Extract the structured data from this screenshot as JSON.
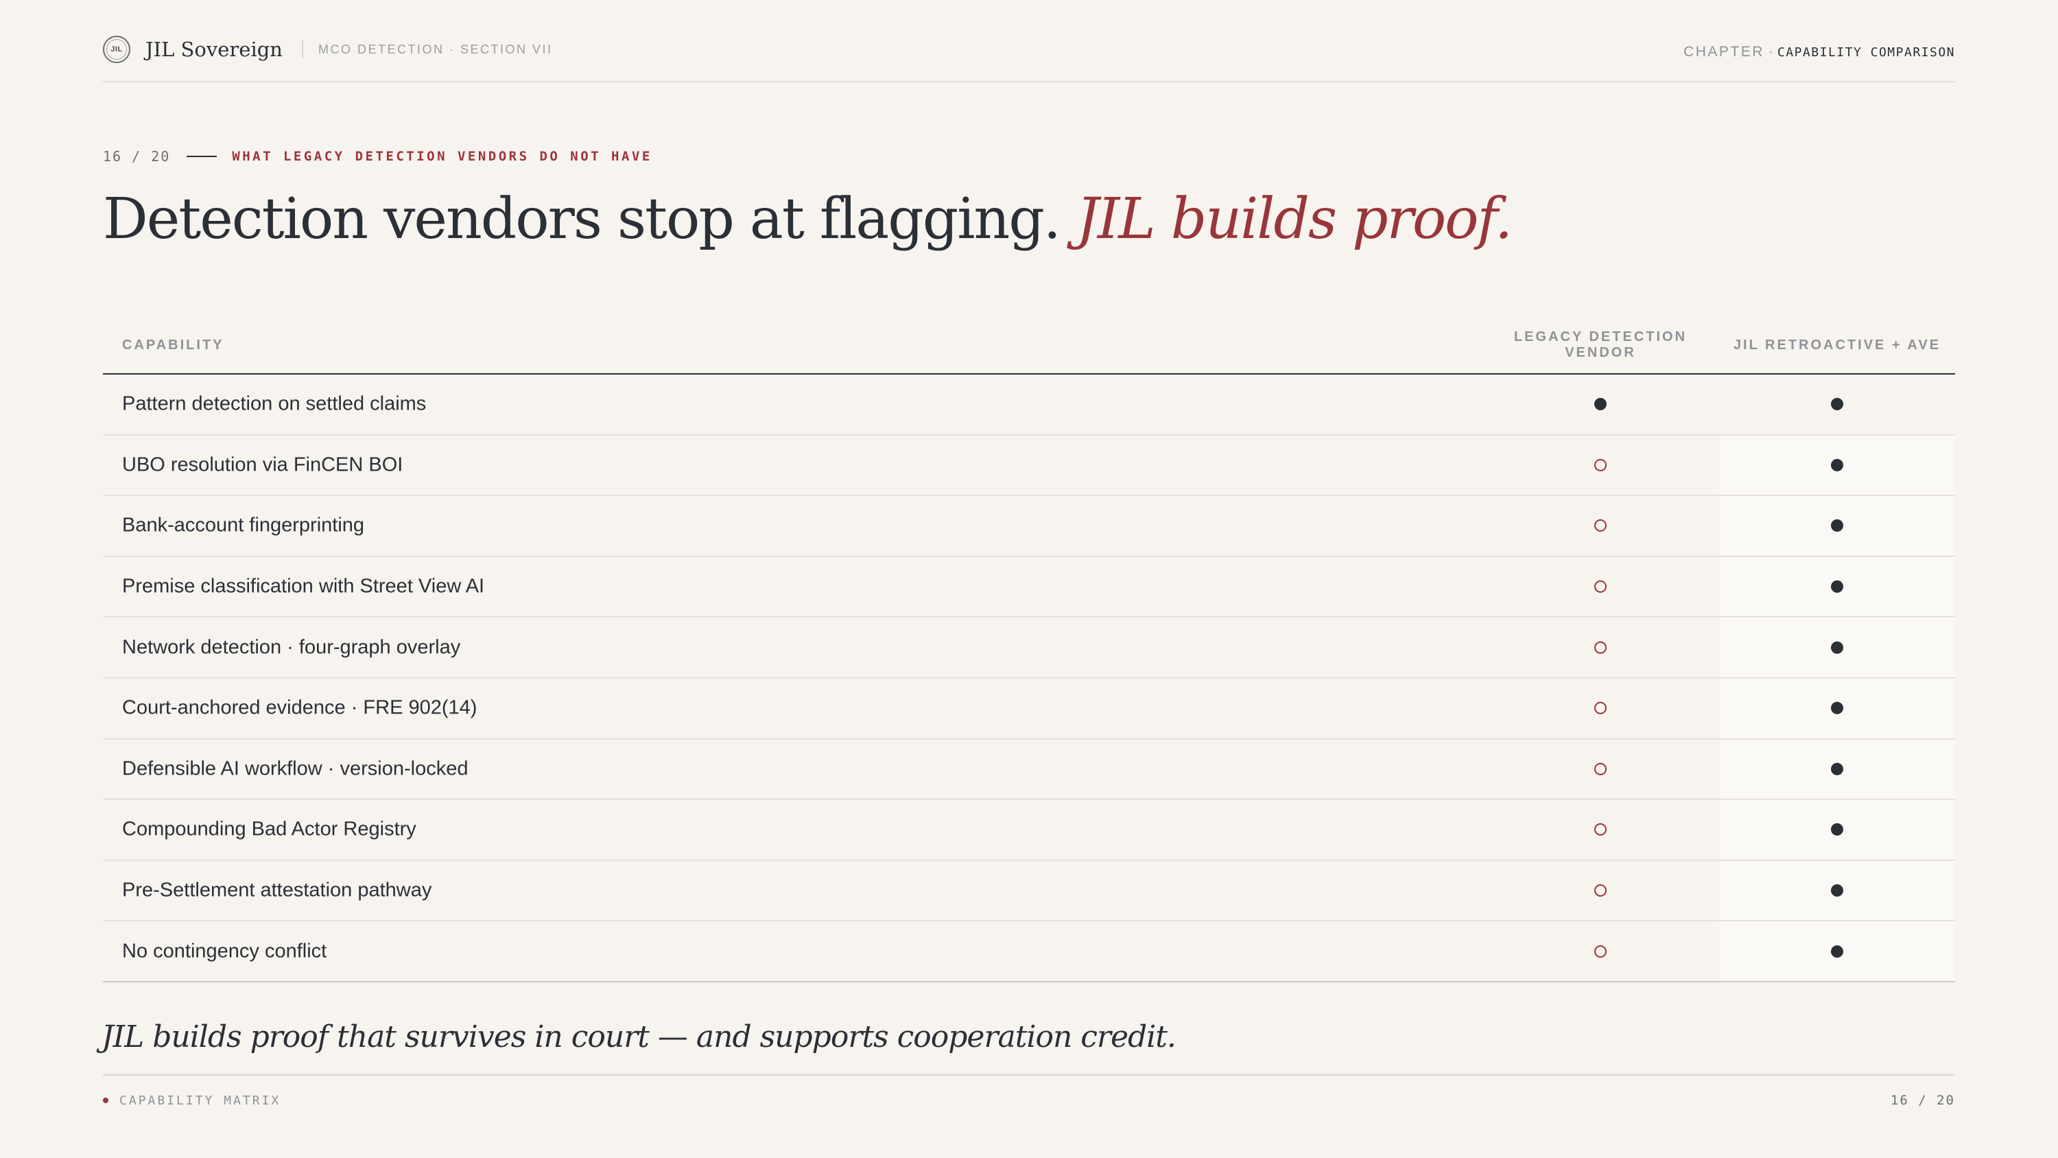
{
  "header": {
    "logo_text": "JIL",
    "brand_name": "JIL Sovereign",
    "section": "MCO DETECTION · SECTION VII",
    "chapter_label": "CHAPTER",
    "chapter_sep": "·",
    "chapter_value": "CAPABILITY COMPARISON"
  },
  "kicker": {
    "page": "16 / 20",
    "text": "WHAT LEGACY DETECTION VENDORS DO NOT HAVE"
  },
  "title": {
    "main": "Detection vendors stop at flagging.",
    "accent": "JIL builds proof."
  },
  "table": {
    "headers": {
      "capability": "CAPABILITY",
      "legacy": "LEGACY DETECTION VENDOR",
      "jil": "JIL RETROACTIVE + AVE"
    },
    "rows": [
      {
        "label": "Pattern detection on settled claims",
        "legacy": true,
        "jil": true
      },
      {
        "label": "UBO resolution via FinCEN BOI",
        "legacy": false,
        "jil": true
      },
      {
        "label": "Bank-account fingerprinting",
        "legacy": false,
        "jil": true
      },
      {
        "label": "Premise classification with Street View AI",
        "legacy": false,
        "jil": true
      },
      {
        "label": "Network detection · four-graph overlay",
        "legacy": false,
        "jil": true
      },
      {
        "label": "Court-anchored evidence · FRE 902(14)",
        "legacy": false,
        "jil": true
      },
      {
        "label": "Defensible AI workflow · version-locked",
        "legacy": false,
        "jil": true
      },
      {
        "label": "Compounding Bad Actor Registry",
        "legacy": false,
        "jil": true
      },
      {
        "label": "Pre-Settlement attestation pathway",
        "legacy": false,
        "jil": true
      },
      {
        "label": "No contingency conflict",
        "legacy": false,
        "jil": true
      }
    ]
  },
  "quote": "JIL builds proof that survives in court — and supports cooperation credit.",
  "footer": {
    "label": "CAPABILITY MATRIX",
    "page": "16 / 20"
  },
  "colors": {
    "accent": "#98363b",
    "ink": "#2b2f36",
    "background": "#f7f3ee"
  }
}
